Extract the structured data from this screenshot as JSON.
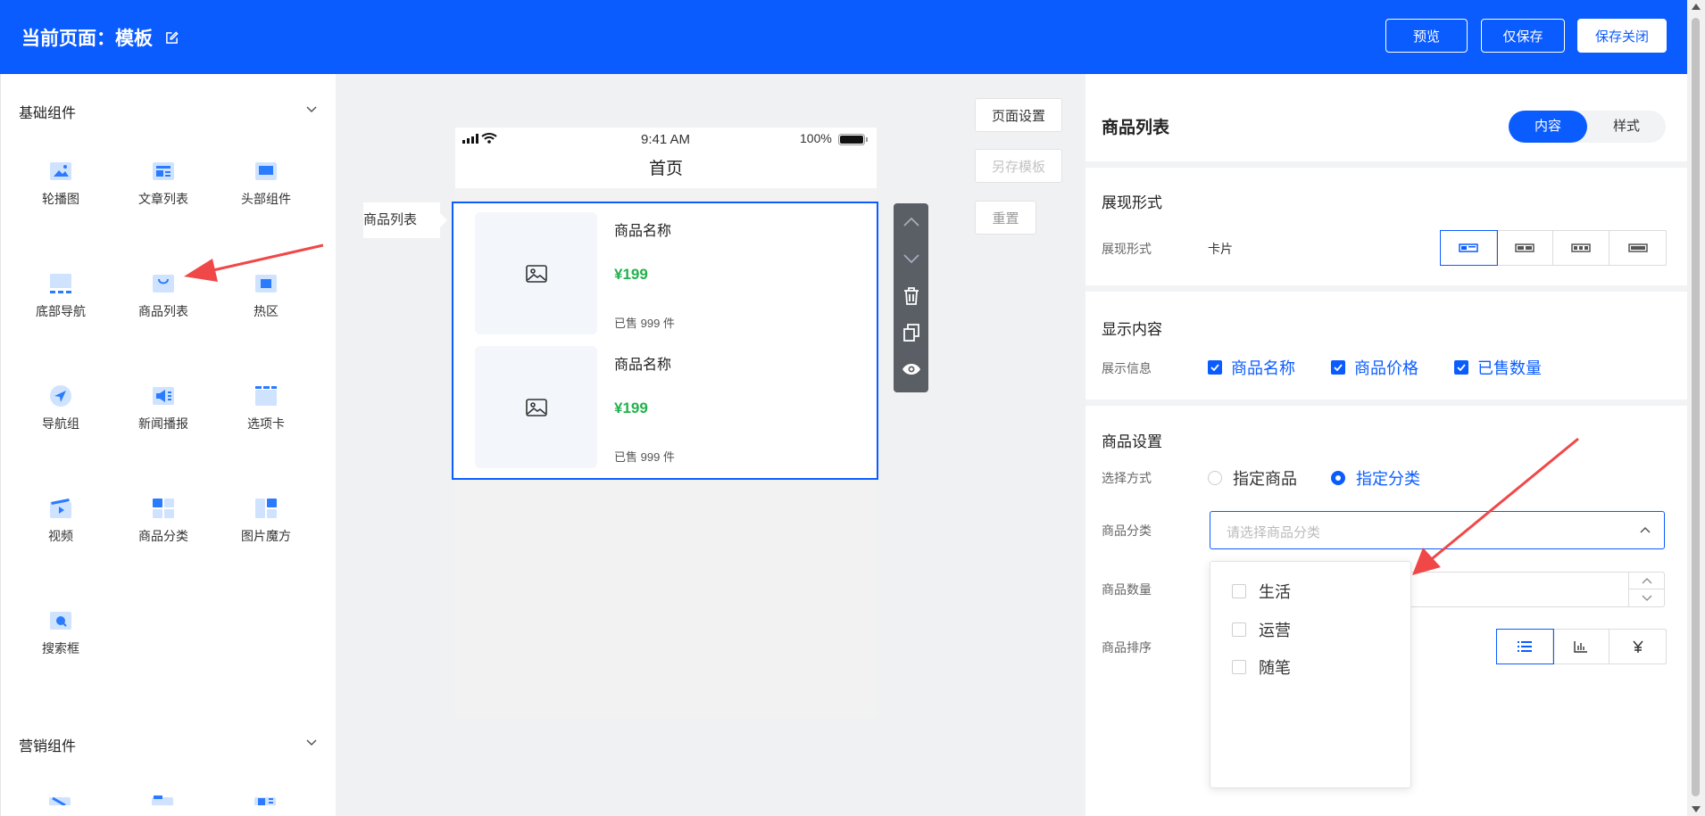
{
  "header": {
    "title": "当前页面：模板",
    "preview_label": "预览",
    "save_only_label": "仅保存",
    "save_close_label": "保存关闭"
  },
  "left_panel": {
    "basic_group_title": "基础组件",
    "basic_items": [
      {
        "label": "轮播图",
        "icon": "image-carousel-icon"
      },
      {
        "label": "文章列表",
        "icon": "article-list-icon"
      },
      {
        "label": "头部组件",
        "icon": "header-component-icon"
      },
      {
        "label": "底部导航",
        "icon": "bottom-nav-icon"
      },
      {
        "label": "商品列表",
        "icon": "product-list-icon"
      },
      {
        "label": "热区",
        "icon": "hotspot-icon"
      },
      {
        "label": "导航组",
        "icon": "nav-group-icon"
      },
      {
        "label": "新闻播报",
        "icon": "news-broadcast-icon"
      },
      {
        "label": "选项卡",
        "icon": "tabs-icon"
      },
      {
        "label": "视频",
        "icon": "video-icon"
      },
      {
        "label": "商品分类",
        "icon": "product-category-icon"
      },
      {
        "label": "图片魔方",
        "icon": "image-cube-icon"
      },
      {
        "label": "搜索框",
        "icon": "search-box-icon"
      }
    ],
    "marketing_group_title": "营销组件"
  },
  "canvas": {
    "status_time": "9:41 AM",
    "status_battery": "100%",
    "page_title": "首页",
    "component_tag": "商品列表",
    "products": [
      {
        "name": "商品名称",
        "price": "¥199",
        "sold": "已售 999 件"
      },
      {
        "name": "商品名称",
        "price": "¥199",
        "sold": "已售 999 件"
      }
    ],
    "page_settings_label": "页面设置",
    "save_template_label": "另存模板",
    "reset_label": "重置"
  },
  "right_panel": {
    "title": "商品列表",
    "tab_content": "内容",
    "tab_style": "样式",
    "display_section": {
      "title": "展现形式",
      "label": "展现形式",
      "value": "卡片"
    },
    "content_section": {
      "title": "显示内容",
      "label": "展示信息",
      "options": [
        "商品名称",
        "商品价格",
        "已售数量"
      ]
    },
    "product_section": {
      "title": "商品设置",
      "select_mode_label": "选择方式",
      "radio_specified_product": "指定商品",
      "radio_specified_category": "指定分类",
      "category_label": "商品分类",
      "category_placeholder": "请选择商品分类",
      "quantity_label": "商品数量",
      "sort_label": "商品排序",
      "dropdown_options": [
        "生活",
        "运营",
        "随笔"
      ]
    }
  },
  "colors": {
    "primary": "#0b5cff",
    "price_green": "#22b14c",
    "annotation_red": "#f04848"
  }
}
